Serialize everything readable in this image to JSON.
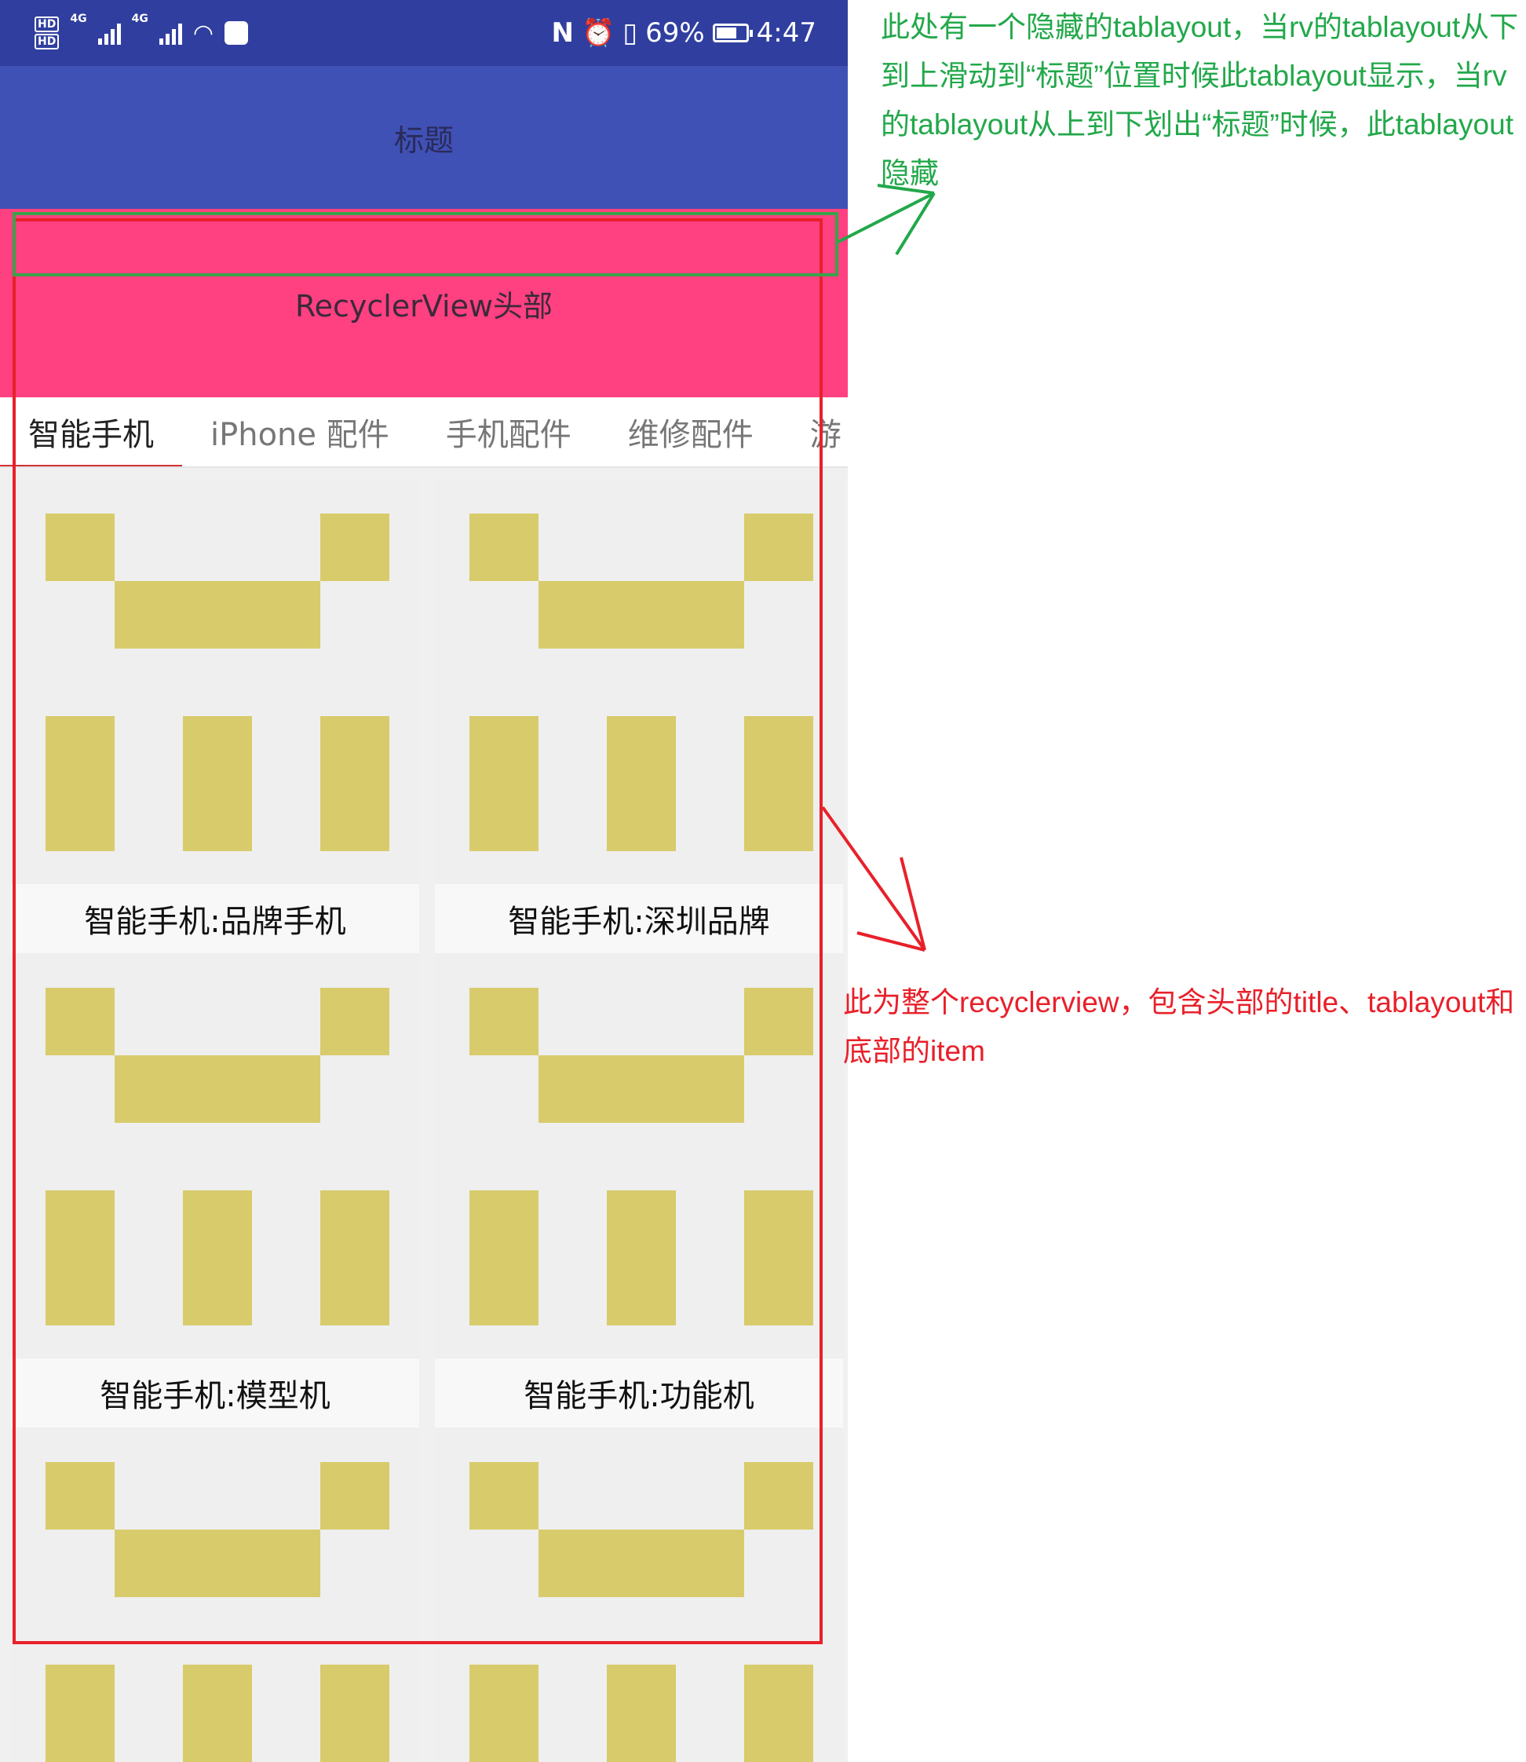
{
  "status_bar": {
    "hd1": "HD",
    "hd2": "HD",
    "net1": "4G",
    "net2": "4G",
    "battery_percent": "69%",
    "battery_level": 0.69,
    "time": "4:47"
  },
  "app": {
    "title": "标题",
    "rv_header": "RecyclerView头部"
  },
  "tabs": [
    {
      "label": "智能手机",
      "active": true
    },
    {
      "label": "iPhone 配件",
      "active": false
    },
    {
      "label": "手机配件",
      "active": false
    },
    {
      "label": "维修配件",
      "active": false
    },
    {
      "label": "游",
      "active": false
    }
  ],
  "items": [
    {
      "caption": "智能手机:品牌手机"
    },
    {
      "caption": "智能手机:深圳品牌"
    },
    {
      "caption": "智能手机:模型机"
    },
    {
      "caption": "智能手机:功能机"
    },
    {
      "caption": ""
    },
    {
      "caption": ""
    }
  ],
  "annotations": {
    "green_note": "此处有一个隐藏的tablayout，当rv的tablayout从下到上滑动到“标题”位置时候此tablayout显示，当rv的tablayout从上到下划出“标题”时候，此tablayout隐藏",
    "red_note": "此为整个recyclerview，包含头部的title、tablayout和底部的item",
    "green_color": "#22a84a",
    "red_color": "#e8202a"
  },
  "colors": {
    "status_bar": "#303f9f",
    "title_bar": "#3f51b5",
    "rv_header": "#ff4081",
    "tab_indicator": "#d32f2f",
    "placeholder_block": "#d8cb6b"
  }
}
